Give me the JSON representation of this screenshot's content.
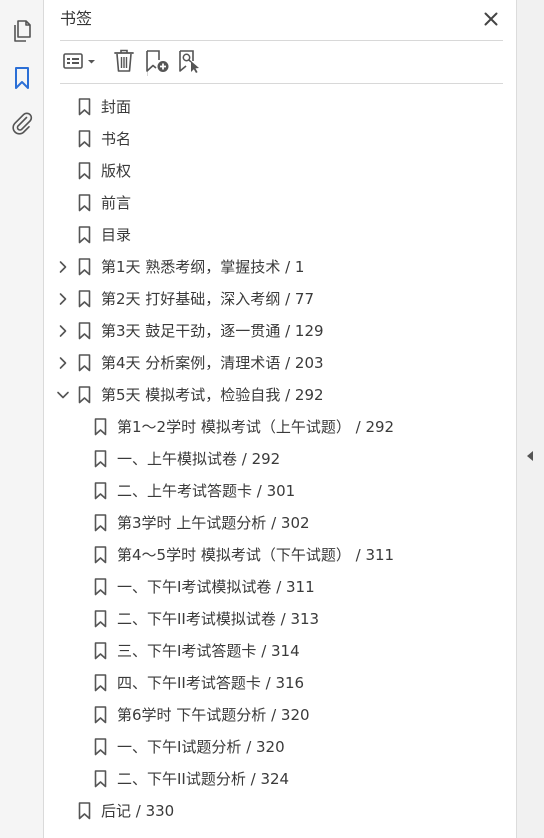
{
  "panel": {
    "title": "书签"
  },
  "rail": {
    "items": [
      {
        "name": "pages-icon",
        "active": false
      },
      {
        "name": "bookmarks-icon",
        "active": true
      },
      {
        "name": "attachments-icon",
        "active": false
      }
    ]
  },
  "toolbar": {
    "options_icon": "list-options-icon",
    "delete_icon": "trash-icon",
    "new_bookmark_icon": "add-bookmark-icon",
    "find_bookmark_icon": "find-current-bookmark-icon"
  },
  "colors": {
    "accent": "#2b6fd6",
    "icon": "#555555",
    "text": "#3a3a3a",
    "rail_bg": "#f5f5f5"
  },
  "bookmarks": [
    {
      "label": "封面",
      "level": 0,
      "expander": "none"
    },
    {
      "label": "书名",
      "level": 0,
      "expander": "none"
    },
    {
      "label": "版权",
      "level": 0,
      "expander": "none"
    },
    {
      "label": "前言",
      "level": 0,
      "expander": "none"
    },
    {
      "label": "目录",
      "level": 0,
      "expander": "none"
    },
    {
      "label": "第1天  熟悉考纲，掌握技术 / 1",
      "level": 0,
      "expander": "collapsed"
    },
    {
      "label": "第2天  打好基础，深入考纲 / 77",
      "level": 0,
      "expander": "collapsed"
    },
    {
      "label": "第3天  鼓足干劲，逐一贯通 / 129",
      "level": 0,
      "expander": "collapsed"
    },
    {
      "label": "第4天  分析案例，清理术语 / 203",
      "level": 0,
      "expander": "collapsed"
    },
    {
      "label": "第5天  模拟考试，检验自我 / 292",
      "level": 0,
      "expander": "expanded"
    },
    {
      "label": "第1～2学时  模拟考试（上午试题） / 292",
      "level": 1,
      "expander": "none"
    },
    {
      "label": "一、上午模拟试卷 / 292",
      "level": 1,
      "expander": "none"
    },
    {
      "label": "二、上午考试答题卡 / 301",
      "level": 1,
      "expander": "none"
    },
    {
      "label": "第3学时  上午试题分析 / 302",
      "level": 1,
      "expander": "none"
    },
    {
      "label": "第4～5学时  模拟考试（下午试题） / 311",
      "level": 1,
      "expander": "none"
    },
    {
      "label": "一、下午I考试模拟试卷 / 311",
      "level": 1,
      "expander": "none"
    },
    {
      "label": "二、下午II考试模拟试卷 / 313",
      "level": 1,
      "expander": "none"
    },
    {
      "label": "三、下午I考试答题卡 / 314",
      "level": 1,
      "expander": "none"
    },
    {
      "label": "四、下午II考试答题卡 / 316",
      "level": 1,
      "expander": "none"
    },
    {
      "label": "第6学时  下午试题分析 / 320",
      "level": 1,
      "expander": "none"
    },
    {
      "label": "一、下午I试题分析 / 320",
      "level": 1,
      "expander": "none"
    },
    {
      "label": "二、下午II试题分析 / 324",
      "level": 1,
      "expander": "none"
    },
    {
      "label": "后记 / 330",
      "level": 0,
      "expander": "none"
    }
  ]
}
